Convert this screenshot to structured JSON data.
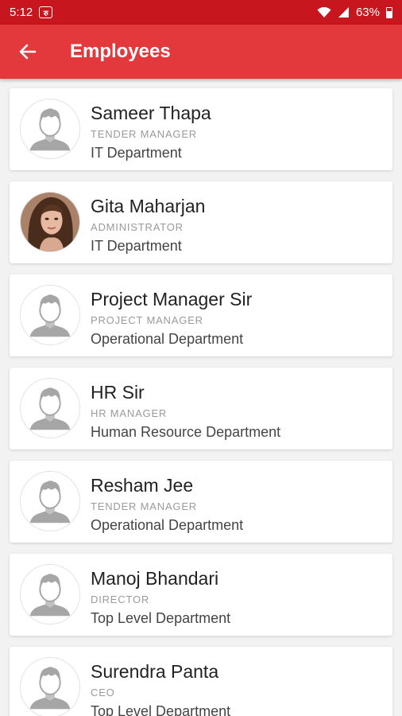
{
  "status_bar": {
    "time": "5:12",
    "notification_text": "रु",
    "battery_percent": "63%"
  },
  "app_bar": {
    "title": "Employees"
  },
  "employees": [
    {
      "name": "Sameer Thapa",
      "role": "TENDER MANAGER",
      "department": "IT Department",
      "avatar": "person-placeholder-icon"
    },
    {
      "name": "Gita Maharjan",
      "role": "ADMINISTRATOR",
      "department": "IT Department",
      "avatar": "profile-photo"
    },
    {
      "name": "Project Manager Sir",
      "role": "PROJECT MANAGER",
      "department": "Operational Department",
      "avatar": "person-placeholder-icon"
    },
    {
      "name": "HR Sir",
      "role": "HR MANAGER",
      "department": "Human Resource Department",
      "avatar": "person-placeholder-icon"
    },
    {
      "name": "Resham Jee",
      "role": "TENDER MANAGER",
      "department": "Operational Department",
      "avatar": "person-placeholder-icon"
    },
    {
      "name": "Manoj Bhandari",
      "role": "DIRECTOR",
      "department": "Top Level Department",
      "avatar": "person-placeholder-icon"
    },
    {
      "name": "Surendra Panta",
      "role": "CEO",
      "department": "Top Level Department",
      "avatar": "person-placeholder-icon"
    }
  ],
  "colors": {
    "status_bar": "#c8161e",
    "app_bar": "#e3393c",
    "placeholder_gray": "#a6a6a6"
  }
}
